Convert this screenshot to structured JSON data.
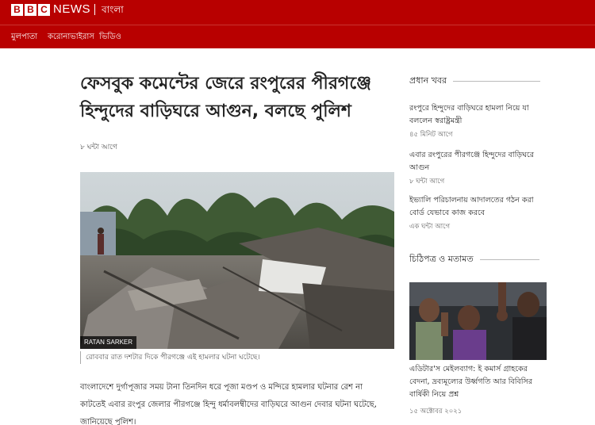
{
  "header": {
    "logo_letters": [
      "B",
      "B",
      "C"
    ],
    "news_label": "NEWS",
    "language": "বাংলা"
  },
  "nav": {
    "items": [
      {
        "label": "মুলপাতা"
      },
      {
        "label": "করোনাভাইরাস"
      },
      {
        "label": "ভিডিও"
      }
    ]
  },
  "article": {
    "headline": "ফেসবুক কমেন্টের জেরে রংপুরের পীরগঞ্জে হিন্দুদের বাড়িঘরে আগুন, বলছে পুলিশ",
    "timestamp": "৮ ঘন্টা আগে",
    "image_credit": "RATAN SARKER",
    "image_caption": "রোববার রাত দশটার দিকে পীরগঞ্জে এই হামলার ঘটনা ঘটেছে।",
    "body": "বাংলাদেশে দুর্গাপূজার সময় টানা তিনদিন ধরে পূজা মণ্ডপ ও মন্দিরে হামলার ঘটনার রেশ না কাটতেই এবার রংপুর জেলার পীরগঞ্জে হিন্দু ধর্মাবলম্বীদের বাড়িঘরে আগুন দেবার ঘটনা ঘটেছে, জানিয়েছে পুলিশ।"
  },
  "sidebar": {
    "top_stories_heading": "প্রধান খবর",
    "top_stories": [
      {
        "title": "রংপুরে হিন্দুদের বাড়িঘরে হামলা নিয়ে যা বললেন স্বরাষ্ট্রমন্ত্রী",
        "time": "৪৫ মিনিট আগে"
      },
      {
        "title": "এবার রংপুরের পীরগঞ্জে হিন্দুদের বাড়িঘরে আগুন",
        "time": "৮ ঘন্টা আগে"
      },
      {
        "title": "ইভ্যালি পরিচালনায় আদালতের গঠন করা বোর্ড যেভাবে কাজ করবে",
        "time": "এক ঘন্টা আগে"
      }
    ],
    "opinion_heading": "চিঠিপত্র ও মতামত",
    "opinion_story": {
      "title": "এডিটার'স মেইলব্যাগ: ই কমার্স গ্রাহকের বেদনা, দ্রব্যমূল্যের উর্ধ্বগতি আর বিবিসির বার্ষিকী নিয়ে প্রশ্ন",
      "time": "১৫ অক্টোবর ২০২১"
    }
  },
  "colors": {
    "brand_red": "#b80000",
    "text": "#222222",
    "muted": "#555555"
  }
}
